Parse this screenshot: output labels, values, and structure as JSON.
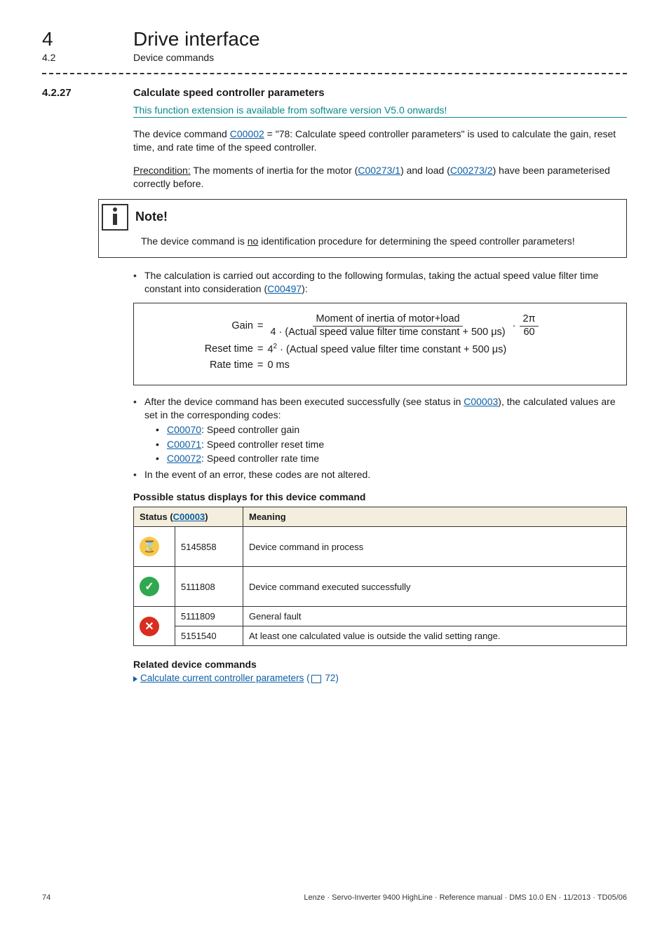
{
  "chapter": {
    "num": "4",
    "title": "Drive interface"
  },
  "subchapter": {
    "num": "4.2",
    "title": "Device commands"
  },
  "section": {
    "num": "4.2.27",
    "title": "Calculate speed controller parameters"
  },
  "teal_note": "This function extension is available from software version V5.0 onwards!",
  "para1": {
    "pre": "The device command ",
    "code_link": "C00002",
    "post": " = \"78: Calculate speed controller parameters\" is used to calculate the gain, reset time, and rate time of the speed controller."
  },
  "para2": {
    "pre_u": "Precondition:",
    "mid1": " The moments of inertia for the motor (",
    "link1": "C00273/1",
    "mid2": ") and load (",
    "link2": "C00273/2",
    "mid3": ") have been parameterised correctly before."
  },
  "note": {
    "title": "Note!",
    "body_pre": "The device command is ",
    "body_u": "no",
    "body_post": " identification procedure for determining the speed controller parameters!"
  },
  "bullet_calc": {
    "pre": "The calculation is carried out according to the following formulas, taking the actual speed value filter time constant into consideration (",
    "link": "C00497",
    "post": "):"
  },
  "formula": {
    "gain_label": "Gain",
    "eq": "=",
    "gain_num": "Moment of inertia of motor+load",
    "gain_den_pre": "4 · (Actual speed value filter time constant + 500 μs)",
    "twopi_num": "2π",
    "twopi_den": "60",
    "dot": "·",
    "reset_label": "Reset time",
    "reset_rhs_pre": "4",
    "reset_rhs_post": " · (Actual speed value filter time constant + 500 μs)",
    "rate_label": "Rate time",
    "rate_rhs": "0 ms"
  },
  "bullet_after": {
    "pre": "After the device command has been executed successfully (see status in ",
    "link": "C00003",
    "post": "), the calculated values are set in the corresponding codes:"
  },
  "subbullets": [
    {
      "link": "C00070",
      "text": ": Speed controller gain"
    },
    {
      "link": "C00071",
      "text": ": Speed controller reset time"
    },
    {
      "link": "C00072",
      "text": ": Speed controller rate time"
    }
  ],
  "bullet_error": "In the event of an error, these codes are not altered.",
  "status_heading": "Possible status displays for this device command",
  "table": {
    "h1_pre": "Status (",
    "h1_link": "C00003",
    "h1_post": ")",
    "h2": "Meaning",
    "rows": [
      {
        "icon": "wait",
        "code": "5145858",
        "meaning": "Device command in process"
      },
      {
        "icon": "ok",
        "code": "5111808",
        "meaning": "Device command executed successfully"
      },
      {
        "icon": "err",
        "code": "5111809",
        "meaning": "General fault"
      },
      {
        "icon": "err",
        "code": "5151540",
        "meaning": "At least one calculated value is outside the valid setting range."
      }
    ]
  },
  "related": {
    "heading": "Related device commands",
    "link_text": "Calculate current controller parameters",
    "page_ref": "72"
  },
  "footer": {
    "page": "74",
    "right": "Lenze · Servo-Inverter 9400 HighLine · Reference manual · DMS 10.0 EN · 11/2013 · TD05/06"
  },
  "icons": {
    "wait_glyph": "⌛",
    "ok_glyph": "✓",
    "err_glyph": "✕"
  }
}
